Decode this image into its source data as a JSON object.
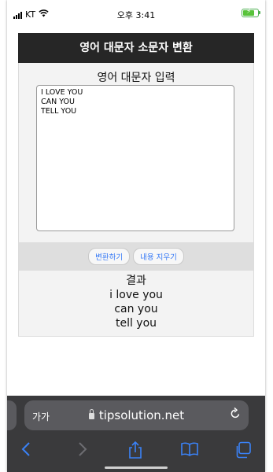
{
  "status_bar": {
    "carrier": "KT",
    "time": "오후 3:41"
  },
  "page": {
    "title": "영어 대문자 소문자 변환",
    "input_label": "영어 대문자 입력",
    "input_value": "I LOVE YOU\nCAN YOU\nTELL YOU",
    "buttons": {
      "convert": "변환하기",
      "clear": "내용 지우기"
    },
    "result": {
      "title": "결과",
      "lines": [
        "i love you",
        "can you",
        "tell you"
      ]
    }
  },
  "browser": {
    "text_size_button": "가가",
    "url": "tipsolution.net"
  },
  "colors": {
    "header_bg": "#262626",
    "accent": "#3478f6",
    "battery": "#58c33a"
  },
  "icons": [
    "signal-icon",
    "wifi-icon",
    "battery-charging-icon",
    "lock-icon",
    "reload-icon",
    "back-icon",
    "forward-icon",
    "share-icon",
    "bookmarks-icon",
    "tabs-icon"
  ]
}
